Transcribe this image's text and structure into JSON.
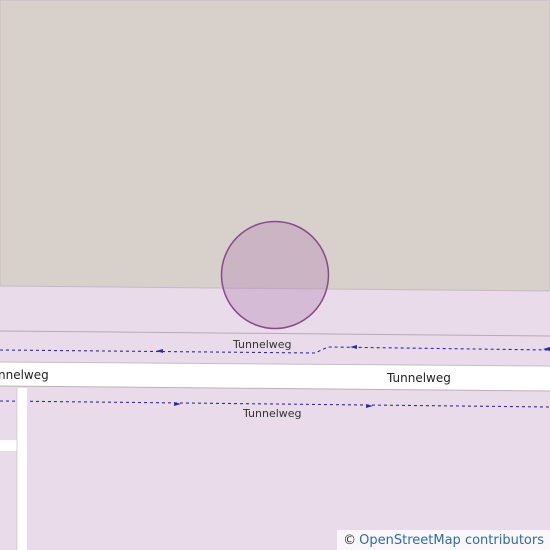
{
  "map": {
    "colors": {
      "industrial_area": "#d8d0cb",
      "residential_area": "#e9dbea",
      "road": "#ffffff",
      "road_casing": "#bbb3b3",
      "path_dashed": "#2c2ca8",
      "marker_fill": "#b580b5",
      "marker_stroke": "#8a4a8a"
    },
    "street_labels": {
      "left": "nnelweg",
      "right": "Tunnelweg",
      "path_upper": "Tunnelweg",
      "path_lower": "Tunnelweg"
    },
    "marker": "location-circle"
  },
  "attribution": {
    "copyright_symbol": "©",
    "link_text": "OpenStreetMap contributors"
  }
}
